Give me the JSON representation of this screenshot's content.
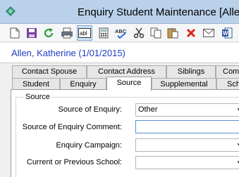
{
  "window": {
    "title": "Enquiry Student Maintenance  [Alle"
  },
  "toolbar": {
    "buttons": [
      "new-icon",
      "save-icon",
      "refresh-icon",
      "print-icon",
      "text-field-icon",
      "calculator-icon",
      "spell-check-icon",
      "cut-icon",
      "copy-icon",
      "paste-icon",
      "delete-icon",
      "email-icon",
      "word-icon"
    ]
  },
  "student": {
    "name": "Allen, Katherine (1/01/2015)"
  },
  "tabs": {
    "row1": [
      "Contact Spouse",
      "Contact Address",
      "Siblings",
      "Comm"
    ],
    "row2": [
      "Student",
      "Enquiry",
      "Source",
      "Supplemental",
      "Sch"
    ],
    "active": "Source"
  },
  "source_group": {
    "title": "Source",
    "fields": [
      {
        "label": "Source of Enquiry:",
        "value": "Other",
        "type": "select"
      },
      {
        "label": "Source of Enquiry Comment:",
        "value": "",
        "type": "text"
      },
      {
        "label": "Enquiry Campaign:",
        "value": "",
        "type": "select"
      },
      {
        "label": "Current or Previous School:",
        "value": "",
        "type": "select"
      }
    ]
  }
}
